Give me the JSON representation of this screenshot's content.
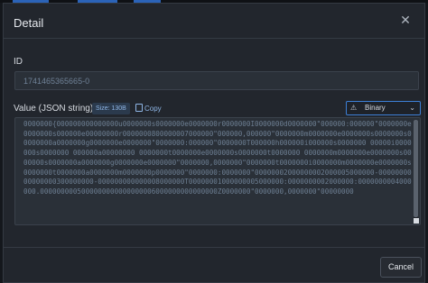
{
  "dialog": {
    "title": "Detail",
    "close_icon": "close-icon"
  },
  "id_field": {
    "label": "ID",
    "value": "1741465365665-0"
  },
  "value_field": {
    "label": "Value (JSON string)",
    "size_badge": "Size: 130B",
    "copy_label": "Copy",
    "copy_icon": "copy-icon",
    "mode_icon": "warning-icon",
    "mode": "Binary",
    "content": "0000000{000000000000000u0000000s0000000e0000000r0000000I0000000d0000000\"000000:000000\"0000000e0000000s000000e00000000r0000000800000007000000\"000000,000000\"0000000m0000000e0000000s0000000s00000000a0000000g0000000e0000000\"0000000:000000\"0000000T000000h000000i000000s0000000 00000i0000000s0000000 000000a00000000 0000000t0000000e0000000s0000000t0000000 0000000m0000000e0000000s0000000s0000000a0000000g0000000e0000000\"0000000,0000000\"0000000t0000000i0000000m0000000e0000000s0000000t0000000a0000000m0000000p0000000\"0000000:0000000\"00000002000000002000005000000-0000000000000000300000000-000000000000008000000T00000001000000005000000:0000000002000000:0000000004000000.0000000005000000000000000006000000000000000Z0000000\"0000000,0000000\"00000000"
  },
  "footer": {
    "cancel_label": "Cancel"
  }
}
